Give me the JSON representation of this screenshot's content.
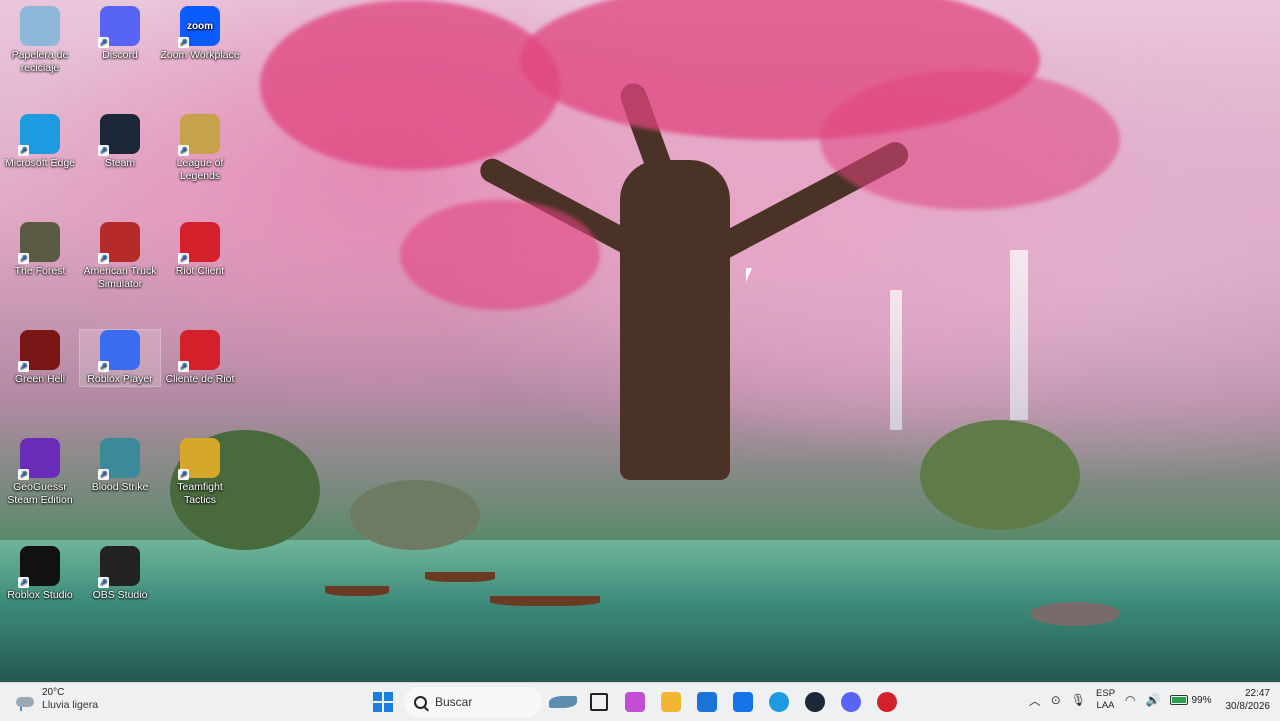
{
  "desktop": {
    "icons": [
      {
        "label": "Papelera de reciclaje",
        "icon": "recycle-bin-icon",
        "color": "#8fb7d9"
      },
      {
        "label": "Discord",
        "icon": "discord-icon",
        "color": "#5865F2"
      },
      {
        "label": "Zoom Workplace",
        "icon": "zoom-icon",
        "color": "#0b5cff",
        "glyph": "zoom"
      },
      {
        "label": "Microsoft Edge",
        "icon": "edge-icon",
        "color": "#1e9be0"
      },
      {
        "label": "Steam",
        "icon": "steam-icon",
        "color": "#1b2838"
      },
      {
        "label": "League of Legends",
        "icon": "league-of-legends-icon",
        "color": "#c8a24b"
      },
      {
        "label": "The Forest",
        "icon": "the-forest-icon",
        "color": "#5b5a45"
      },
      {
        "label": "American Truck Simulator",
        "icon": "american-truck-simulator-icon",
        "color": "#b62a2a"
      },
      {
        "label": "Riot Client",
        "icon": "riot-client-icon",
        "color": "#d3202b"
      },
      {
        "label": "Green Hell",
        "icon": "green-hell-icon",
        "color": "#7a1515"
      },
      {
        "label": "Roblox Player",
        "icon": "roblox-player-icon",
        "color": "#3a6cf0"
      },
      {
        "label": "Cliente de Riot",
        "icon": "riot-client-icon",
        "color": "#d3202b"
      },
      {
        "label": "GeoGuessr Steam Edition",
        "icon": "geoguessr-icon",
        "color": "#6a2bb8"
      },
      {
        "label": "Blood Strike",
        "icon": "blood-strike-icon",
        "color": "#3a8a9a"
      },
      {
        "label": "Teamfight Tactics",
        "icon": "teamfight-tactics-icon",
        "color": "#d6a72a"
      },
      {
        "label": "Roblox Studio",
        "icon": "roblox-studio-icon",
        "color": "#111111"
      },
      {
        "label": "OBS Studio",
        "icon": "obs-studio-icon",
        "color": "#222222"
      }
    ]
  },
  "taskbar": {
    "weather": {
      "temp": "20°C",
      "condition": "Lluvia ligera",
      "icon": "weather-rain-icon"
    },
    "search_label": "Buscar",
    "apps": [
      {
        "name": "widgets",
        "icon": "shark-widget-icon",
        "color": "#5a8fb0"
      },
      {
        "name": "task-view",
        "icon": "task-view-icon",
        "color": "#222222"
      },
      {
        "name": "copilot",
        "icon": "copilot-icon",
        "color": "#c24fd3"
      },
      {
        "name": "file-explorer",
        "icon": "folder-icon",
        "color": "#f2b632"
      },
      {
        "name": "microsoft-store",
        "icon": "store-icon",
        "color": "#1a73d9"
      },
      {
        "name": "outlook",
        "icon": "outlook-icon",
        "color": "#1473e6"
      },
      {
        "name": "edge",
        "icon": "edge-icon",
        "color": "#1e9be0"
      },
      {
        "name": "steam",
        "icon": "steam-icon",
        "color": "#1b2838"
      },
      {
        "name": "discord",
        "icon": "discord-icon",
        "color": "#5865F2"
      },
      {
        "name": "riot",
        "icon": "riot-client-icon",
        "color": "#d3202b"
      }
    ],
    "tray": {
      "lang_line1": "ESP",
      "lang_line2": "LAA",
      "battery": "99%",
      "battery_level": 0.99,
      "time": "22:47",
      "date": "30/8/2026"
    }
  }
}
